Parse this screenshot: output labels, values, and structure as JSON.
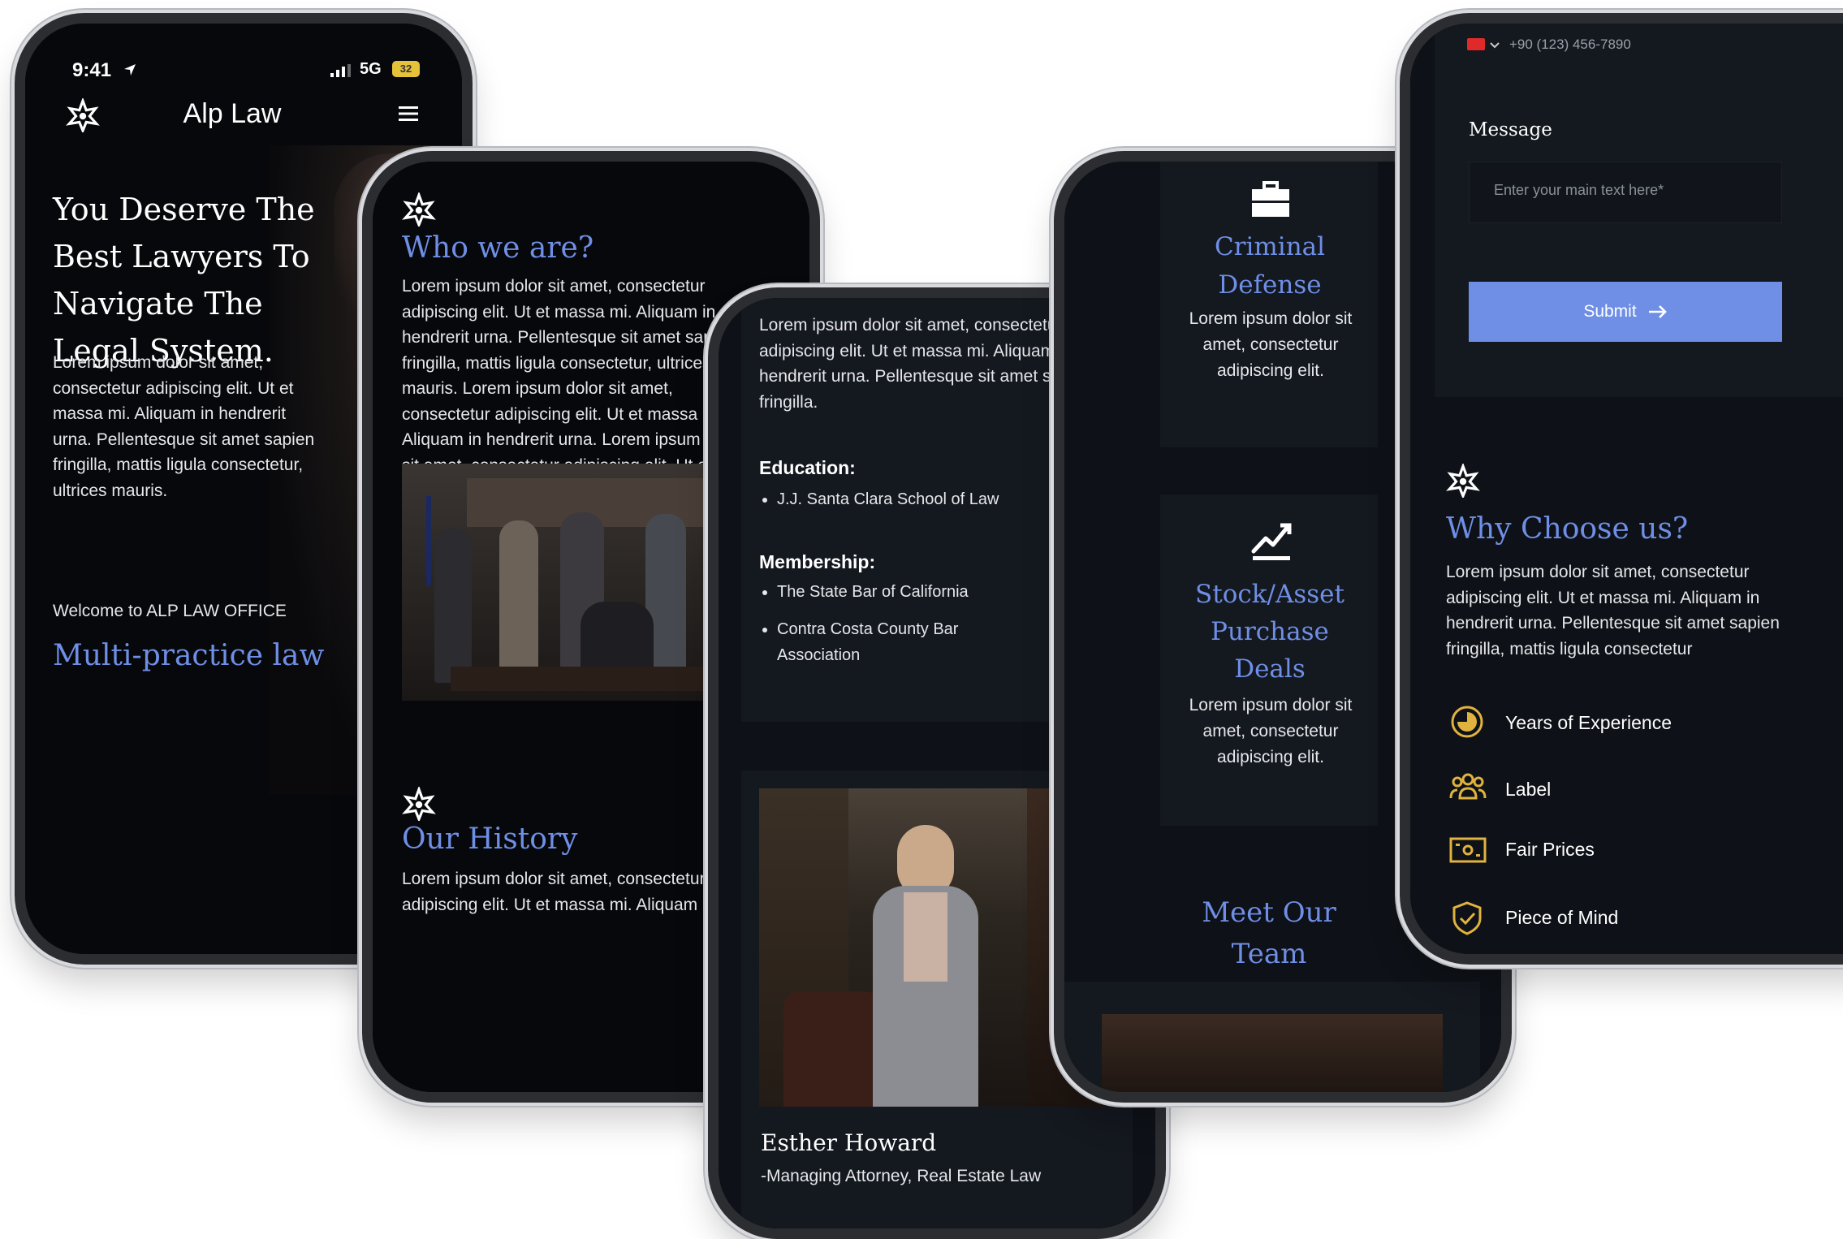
{
  "p1": {
    "time": "9:41",
    "signal": "5G",
    "battery": "32",
    "brand": "Alp Law",
    "hero": "You Deserve The Best Lawyers To Navigate The Legal System.",
    "intro": "Lorem ipsum dolor sit amet, consectetur adipiscing elit. Ut et massa mi. Aliquam in hendrerit urna. Pellentesque sit amet sapien fringilla, mattis ligula consectetur, ultrices mauris.",
    "welcome": "Welcome to ALP LAW OFFICE",
    "practice": "Multi-practice law"
  },
  "p2": {
    "who_title": "Who we are?",
    "who_text": "Lorem ipsum dolor sit amet, consectetur adipiscing elit. Ut et massa mi. Aliquam in hendrerit urna. Pellentesque sit amet sapien fringilla, mattis ligula consectetur, ultrices mauris. Lorem ipsum dolor sit amet, consectetur adipiscing elit. Ut et massa mi. Aliquam in hendrerit urna. Lorem ipsum dolor sit amet, consectetur adipiscing elit. Ut et massa mi. Aliquam in hendrerit urna.",
    "history_title": "Our History",
    "history_text": "Lorem ipsum dolor sit amet, consectetur adipiscing elit. Ut et massa mi. Aliquam"
  },
  "p3": {
    "bio": "Lorem ipsum dolor sit amet, consectetur adipiscing elit. Ut et massa mi. Aliquam in hendrerit urna. Pellentesque sit amet sapien fringilla.",
    "education_label": "Education:",
    "education": [
      "J.J. Santa Clara School of Law"
    ],
    "membership_label": "Membership:",
    "membership": [
      "The State Bar of California",
      "Contra Costa County Bar Association"
    ],
    "name": "Esther Howard",
    "role": "-Managing Attorney, Real Estate Law"
  },
  "p4": {
    "service1_title": "Criminal Defense",
    "service1_text": "Lorem ipsum dolor sit amet, consectetur adipiscing elit.",
    "service2_title": "Stock/Asset Purchase Deals",
    "service2_text": "Lorem ipsum dolor sit amet, consectetur adipiscing elit.",
    "team_title": "Meet Our Team"
  },
  "p5": {
    "phone_placeholder": "+90 (123) 456-7890",
    "message_label": "Message",
    "message_placeholder": "Enter your main text here*",
    "submit": "Submit",
    "why_title": "Why Choose us?",
    "why_text": "Lorem ipsum dolor sit amet, consectetur adipiscing elit. Ut et massa mi. Aliquam in hendrerit urna. Pellentesque sit amet sapien fringilla, mattis ligula consectetur",
    "features": [
      "Years of Experience",
      "Label",
      "Fair Prices",
      "Piece of Mind"
    ]
  },
  "colors": {
    "accent": "#6f8fe6",
    "gold": "#e0b33f",
    "background": "#07080b",
    "card": "#14181f"
  }
}
